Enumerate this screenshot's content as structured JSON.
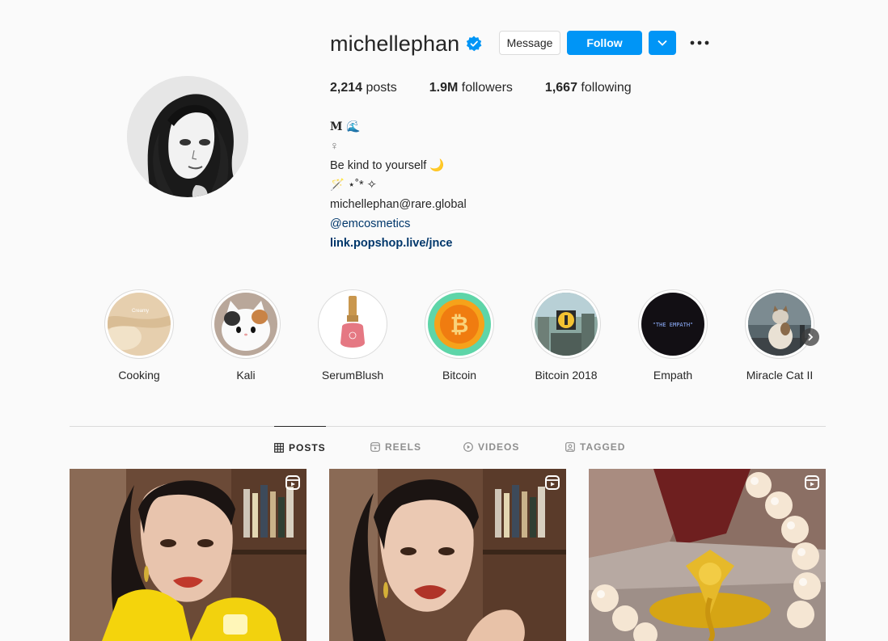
{
  "profile": {
    "username": "michellephan",
    "verified": true,
    "message_label": "Message",
    "follow_label": "Follow",
    "dropdown_icon": "chevron-down-icon",
    "more_icon": "more-dots-icon"
  },
  "stats": {
    "posts_count": "2,214",
    "posts_label": "posts",
    "followers_count": "1.9M",
    "followers_label": "followers",
    "following_count": "1,667",
    "following_label": "following"
  },
  "bio": {
    "name": "𝐌 🌊",
    "line2": "♀",
    "line3": "Be kind to yourself 🌙",
    "line4": "🪄 ⋆˚* ✧",
    "email": "michellephan@rare.global",
    "mention": "@emcosmetics",
    "link": "link.popshop.live/jnce"
  },
  "highlights": [
    {
      "label": "Cooking"
    },
    {
      "label": "Kali"
    },
    {
      "label": "SerumBlush"
    },
    {
      "label": "Bitcoin"
    },
    {
      "label": "Bitcoin 2018"
    },
    {
      "label": "Empath"
    },
    {
      "label": "Miracle Cat II"
    }
  ],
  "highlight_texts": {
    "cooking_overlay": "Creamy",
    "empath_overlay": "\"THE EMPATH\""
  },
  "tabs": [
    {
      "label": "POSTS",
      "icon": "grid-icon",
      "active": true
    },
    {
      "label": "REELS",
      "icon": "reels-icon",
      "active": false
    },
    {
      "label": "VIDEOS",
      "icon": "play-icon",
      "active": false
    },
    {
      "label": "TAGGED",
      "icon": "tagged-icon",
      "active": false
    }
  ],
  "posts": [
    {
      "type": "reel",
      "icon": "reel-icon"
    },
    {
      "type": "reel",
      "icon": "reel-icon"
    },
    {
      "type": "reel",
      "icon": "reel-icon"
    }
  ],
  "colors": {
    "accent": "#0095f6",
    "link": "#00376b",
    "background": "#fafafa"
  }
}
